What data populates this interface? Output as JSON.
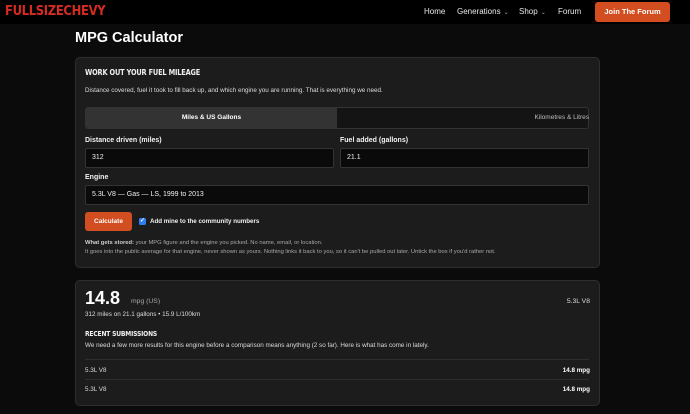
{
  "nav": {
    "logo": "FULLSIZECHEVY",
    "links": [
      "Home",
      "Generations",
      "Shop",
      "Forum"
    ],
    "join": "Join The Forum"
  },
  "page_title": "MPG Calculator",
  "form": {
    "heading": "WORK OUT YOUR FUEL MILEAGE",
    "intro": "Distance covered, fuel it took to fill back up, and which engine you are running. That is everything we need.",
    "tabs": [
      "Miles & US Gallons",
      "Kilometres & Litres"
    ],
    "distance_label": "Distance driven (miles)",
    "distance_value": "312",
    "fuel_label": "Fuel added (gallons)",
    "fuel_value": "21.1",
    "engine_label": "Engine",
    "engine_value": "5.3L V8 — Gas — LS, 1999 to 2013",
    "calculate": "Calculate",
    "checkbox_label": "Add mine to the community numbers",
    "stored_bold": "What gets stored:",
    "stored_text": " your MPG figure and the engine you picked. No name, email, or location.",
    "stored_text2": "It goes into the public average for that engine, never shown as yours. Nothing links it back to you, so it can't be pulled out later. Untick the box if you'd rather not."
  },
  "result": {
    "value": "14.8",
    "unit": "mpg (US)",
    "engine": "5.3L V8",
    "detail": "312 miles on 21.1 gallons • 15.9 L/100km",
    "recent_heading": "RECENT SUBMISSIONS",
    "recent_note": "We need a few more results for this engine before a comparison means anything (2 so far). Here is what has come in lately.",
    "rows": [
      {
        "engine": "5.3L V8",
        "mpg": "14.8 mpg"
      },
      {
        "engine": "5.3L V8",
        "mpg": "14.8 mpg"
      }
    ]
  }
}
